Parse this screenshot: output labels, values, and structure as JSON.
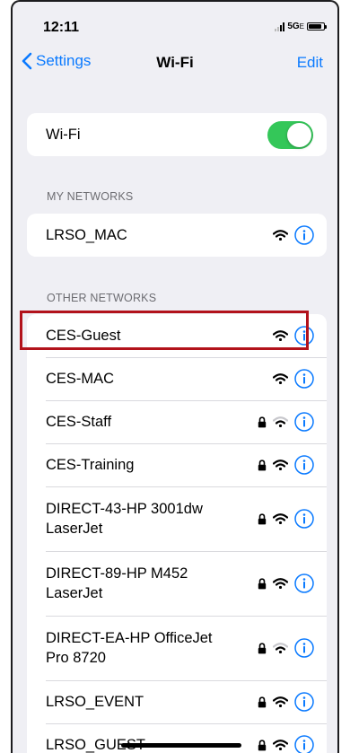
{
  "status_bar": {
    "time": "12:11",
    "network": "5G",
    "network_suffix": "E"
  },
  "nav": {
    "back_label": "Settings",
    "title": "Wi-Fi",
    "edit_label": "Edit"
  },
  "wifi_toggle": {
    "label": "Wi-Fi",
    "state": "on",
    "color": "#34c759"
  },
  "my_networks": {
    "header": "MY NETWORKS",
    "items": [
      {
        "name": "LRSO_MAC",
        "locked": false,
        "signal": "full"
      }
    ]
  },
  "other_networks": {
    "header": "OTHER NETWORKS",
    "items": [
      {
        "name": "CES-Guest",
        "locked": false,
        "signal": "full",
        "highlighted": true
      },
      {
        "name": "CES-MAC",
        "locked": false,
        "signal": "full"
      },
      {
        "name": "CES-Staff",
        "locked": true,
        "signal": "weak"
      },
      {
        "name": "CES-Training",
        "locked": true,
        "signal": "full"
      },
      {
        "name": "DIRECT-43-HP 3001dw LaserJet",
        "locked": true,
        "signal": "full"
      },
      {
        "name": "DIRECT-89-HP M452 LaserJet",
        "locked": true,
        "signal": "full"
      },
      {
        "name": "DIRECT-EA-HP OfficeJet Pro 8720",
        "locked": true,
        "signal": "weak"
      },
      {
        "name": "LRSO_EVENT",
        "locked": true,
        "signal": "full"
      },
      {
        "name": "LRSO_GUEST",
        "locked": true,
        "signal": "full"
      }
    ]
  },
  "colors": {
    "accent": "#0a7aff",
    "highlight_border": "#b2121b",
    "background": "#efeff4"
  },
  "icons": {
    "info": "info-circle-icon",
    "wifi": "wifi-icon",
    "lock": "lock-icon",
    "back": "chevron-left-icon"
  }
}
